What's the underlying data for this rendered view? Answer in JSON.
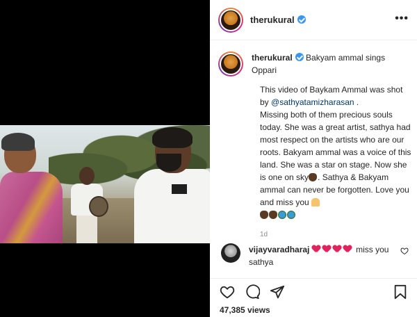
{
  "post": {
    "username": "therukural",
    "verified": true,
    "more_label": "•••"
  },
  "caption": {
    "username": "therukural",
    "title": "Bakyam ammal sings Oppari",
    "line1_before": "This video of Baykam Ammal was shot by ",
    "mention": "@sathyatamizharasan",
    "line1_after": " .",
    "body": "Missing both of them precious souls today. She was a great artist, sathya had most respect on the artists who are our roots. Bakyam ammal was a voice of this land. She was a star on stage. Now she is one on sky",
    "body2": "Sathya & Bakyam ammal can never be forgotten. Love you and miss you",
    "timestamp": "1d"
  },
  "comment": {
    "username": "vijayvaradharaj",
    "text_after": " miss you sathya"
  },
  "actions": {
    "views": "47,385 views"
  },
  "icons": {
    "like": "heart-outline-icon",
    "comment": "comment-bubble-icon",
    "share": "paper-plane-icon",
    "save": "bookmark-icon"
  },
  "colors": {
    "verified": "#3897f0",
    "mention": "#00376b",
    "heart": "#e0245e"
  }
}
